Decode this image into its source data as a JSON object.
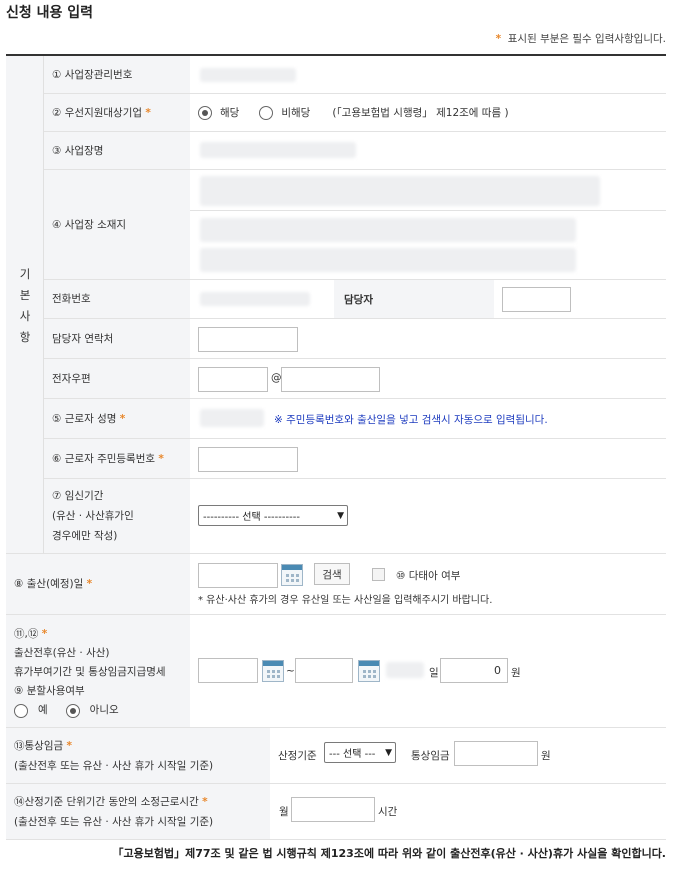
{
  "title": "신청 내용 입력",
  "required_note": "표시된 부분은 필수 입력사항입니다.",
  "group_label": [
    "기",
    "본",
    "사",
    "항"
  ],
  "fields": {
    "f1": "① 사업장관리번호",
    "f2": "② 우선지원대상기업",
    "f2_yes": "해당",
    "f2_no": "비해당",
    "f2_note": "(「고용보험법 시행령」 제12조에 따름 )",
    "f3": "③ 사업장명",
    "f4": "④ 사업장 소재지",
    "phone": "전화번호",
    "manager": "담당자",
    "manager_contact": "담당자 연락처",
    "email": "전자우편",
    "email_at": "@",
    "f5": "⑤ 근로자 성명",
    "f5_note": "※ 주민등록번호와 출산일을 넣고 검색시 자동으로 입력됩니다.",
    "f6": "⑥ 근로자 주민등록번호",
    "f7_lines": [
      "⑦ 임신기간",
      "(유산 · 사산휴가인",
      "경우에만 작성)"
    ],
    "f7_select": "---------- 선택 ----------",
    "f8": "⑧ 출산(예정)일",
    "f8_search": "검색",
    "f10": "⑩ 다태아 여부",
    "f8_note": "* 유산·사산 휴가의 경우 유산일 또는 사산일을 입력해주시기 바랍니다.",
    "f11_head": "⑪,⑫",
    "f11_lines": [
      "출산전후(유산 · 사산)",
      "휴가부여기간 및 통상임금지급명세"
    ],
    "f9": "⑨ 분할사용여부",
    "f9_yes": "예",
    "f9_no": "아니오",
    "tilde": "~",
    "day_unit": "일",
    "amount": "0",
    "won_unit": "원",
    "f13": "⑬통상임금",
    "f13_sub": "(출산전후 또는 유산 · 사산 휴가 시작일 기준)",
    "calc_basis": "산정기준",
    "calc_select": "--- 선택 ---",
    "ordinary_wage": "통상임금",
    "f14": "⑭산정기준 단위기간 동안의 소정근로시간",
    "f14_sub": "(출산전후 또는 유산 · 사산 휴가 시작일 기준)",
    "month": "월",
    "hours": "시간"
  },
  "footer": "「고용보험법」제77조 및 같은 법 시행규칙 제123조에 따라 위와 같이 출산전후(유산 · 사산)휴가 사실을 확인합니다.",
  "colors": {
    "accent_star": "#e8872b",
    "label_bg": "#f4f5f7",
    "note_blue": "#1d3bbf"
  }
}
